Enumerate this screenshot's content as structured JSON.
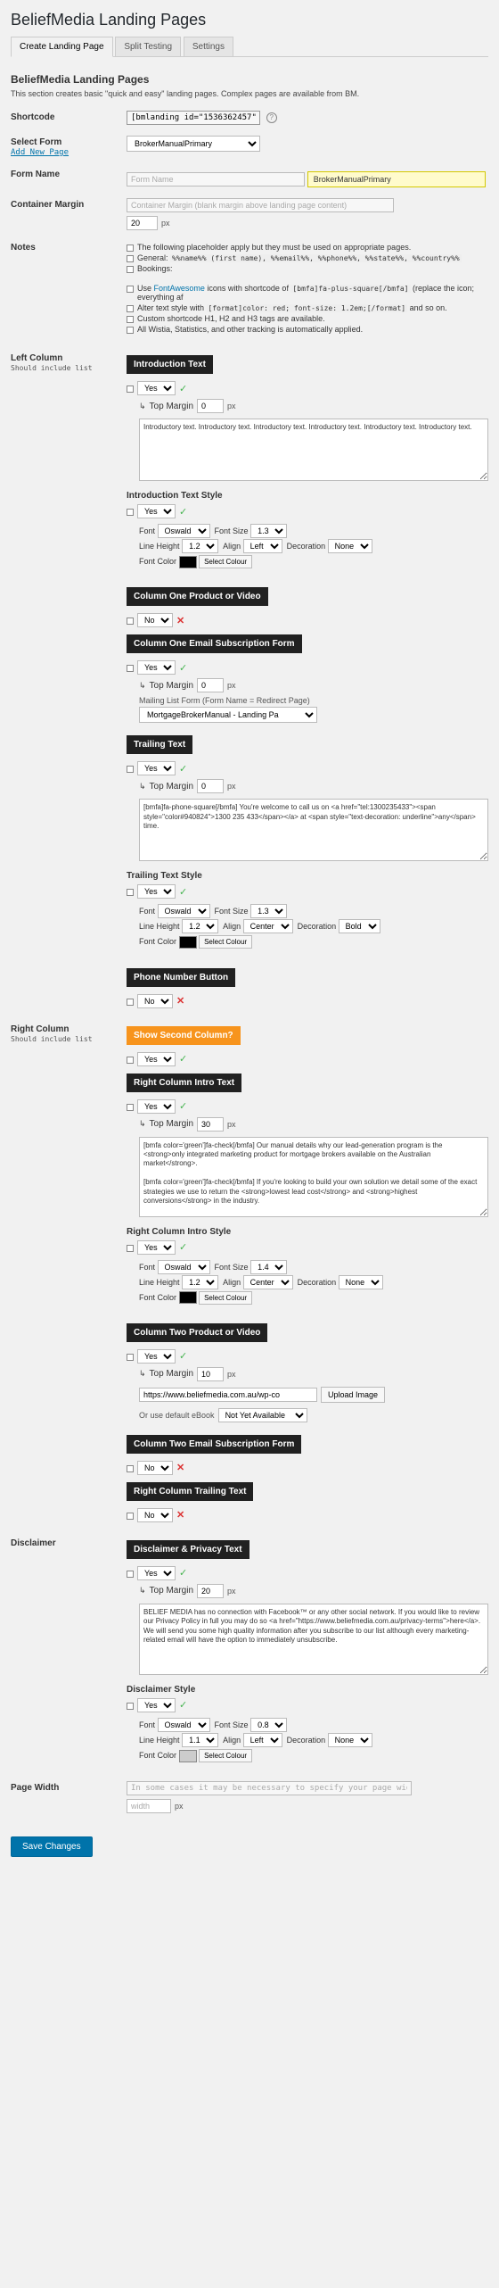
{
  "page_title": "BeliefMedia Landing Pages",
  "tabs": [
    "Create Landing Page",
    "Split Testing",
    "Settings"
  ],
  "sub_heading": "BeliefMedia Landing Pages",
  "intro_desc": "This section creates basic \"quick and easy\" landing pages. Complex pages are available from BM.",
  "rows": {
    "shortcode_label": "Shortcode",
    "shortcode_val": "[bmlanding id=\"1536362457\"]",
    "select_form_label": "Select Form",
    "add_new_page": "Add New Page",
    "select_form_val": "BrokerManualPrimary",
    "form_name_label": "Form Name",
    "form_name_hint": "Form Name",
    "form_name_val": "BrokerManualPrimary",
    "container_margin_label": "Container Margin",
    "container_margin_hint": "Container Margin (blank margin above landing page content)",
    "container_margin_val": "20",
    "notes_label": "Notes",
    "notes": {
      "n1": "The following placeholder apply but they must be used on appropriate pages.",
      "n2_pre": "General: ",
      "n2_codes": "%%name%% (first name), %%email%%, %%phone%%, %%state%%, %%country%%",
      "n3": "Bookings:",
      "n4_pre": "Use ",
      "n4_link": "FontAwesome",
      "n4_mid": " icons with shortcode of ",
      "n4_code": "[bmfa]fa-plus-square[/bmfa]",
      "n4_post": " (replace the icon; everything af",
      "n5_pre": "Alter text style with ",
      "n5_code": "[format]color: red; font-size: 1.2em;[/format]",
      "n5_post": " and so on.",
      "n6": "Custom shortcode H1, H2 and H3 tags are available.",
      "n7": "All Wistia, Statistics, and other tracking is automatically applied."
    },
    "left_col_label": "Left Column",
    "should_include": "Should include list",
    "right_col_label": "Right Column",
    "disclaimer_label": "Disclaimer",
    "page_width_label": "Page Width"
  },
  "common": {
    "yes": "Yes",
    "no": "No",
    "top_margin": "Top Margin",
    "px": "px",
    "font": "Font",
    "font_size": "Font Size",
    "line_height": "Line Height",
    "align": "Align",
    "decoration": "Decoration",
    "font_color": "Font Color",
    "select_colour": "Select Colour",
    "oswald": "Oswald",
    "left": "Left",
    "center": "Center",
    "none": "None",
    "bold": "Bold"
  },
  "sections": {
    "intro_text": "Introduction Text",
    "intro_text_style": "Introduction Text Style",
    "col1_product": "Column One Product or Video",
    "col1_email": "Column One Email Subscription Form",
    "trailing_text": "Trailing Text",
    "trailing_text_style": "Trailing Text Style",
    "phone_btn": "Phone Number Button",
    "show_second": "Show Second Column?",
    "rc_intro": "Right Column Intro Text",
    "rc_intro_style": "Right Column Intro Style",
    "col2_product": "Column Two Product or Video",
    "col2_email": "Column Two Email Subscription Form",
    "rc_trailing": "Right Column Trailing Text",
    "disclaimer_text": "Disclaimer & Privacy Text",
    "disclaimer_style": "Disclaimer Style"
  },
  "intro": {
    "margin": "0",
    "text": "Introductory text. Introductory text. Introductory text. Introductory text. Introductory text. Introductory text.",
    "font_size": "1.3",
    "lh": "1.2"
  },
  "col1_email": {
    "margin": "0",
    "mailing_label": "Mailing List Form (Form Name = Redirect Page)",
    "mailing_val": "MortgageBrokerManual - Landing Pa"
  },
  "trailing": {
    "margin": "0",
    "text": "[bmfa]fa-phone-square[/bmfa] You're welcome to call us on <a href=\"tel:1300235433\"><span style=\"color#940824\">1300 235 433</span></a> at <span style=\"text-decoration: underline\">any</span> time.",
    "font_size": "1.3",
    "lh": "1.2"
  },
  "rc_intro": {
    "margin": "30",
    "text": "[bmfa color='green']fa-check[/bmfa] Our manual details why our lead-generation program is the <strong>only integrated marketing product for mortgage brokers available on the Australian market</strong>.\n\n[bmfa color='green']fa-check[/bmfa] If you're looking to build your own solution we detail some of the exact strategies we use to return the <strong>lowest lead cost</strong> and <strong>highest conversions</strong> in the industry.",
    "font_size": "1.4",
    "lh": "1.2"
  },
  "col2_product": {
    "margin": "10",
    "url": "https://www.beliefmedia.com.au/wp-co",
    "upload": "Upload Image",
    "or_use": "Or use default eBook",
    "not_avail": "Not Yet Available"
  },
  "disclaimer": {
    "margin": "20",
    "text": "BELIEF MEDIA has no connection with Facebook™ or any other social network. If you would like to review our Privacy Policy in full you may do so <a href=\"https://www.beliefmedia.com.au/privacy-terms\">here</a>. We will send you some high quality information after you subscribe to our list although every marketing-related email will have the option to immediately unsubscribe.",
    "font_size": "0.8",
    "lh": "1.1"
  },
  "page_width": {
    "hint": "In some cases it may be necessary to specify your page width.",
    "val": "width"
  },
  "save": "Save Changes"
}
